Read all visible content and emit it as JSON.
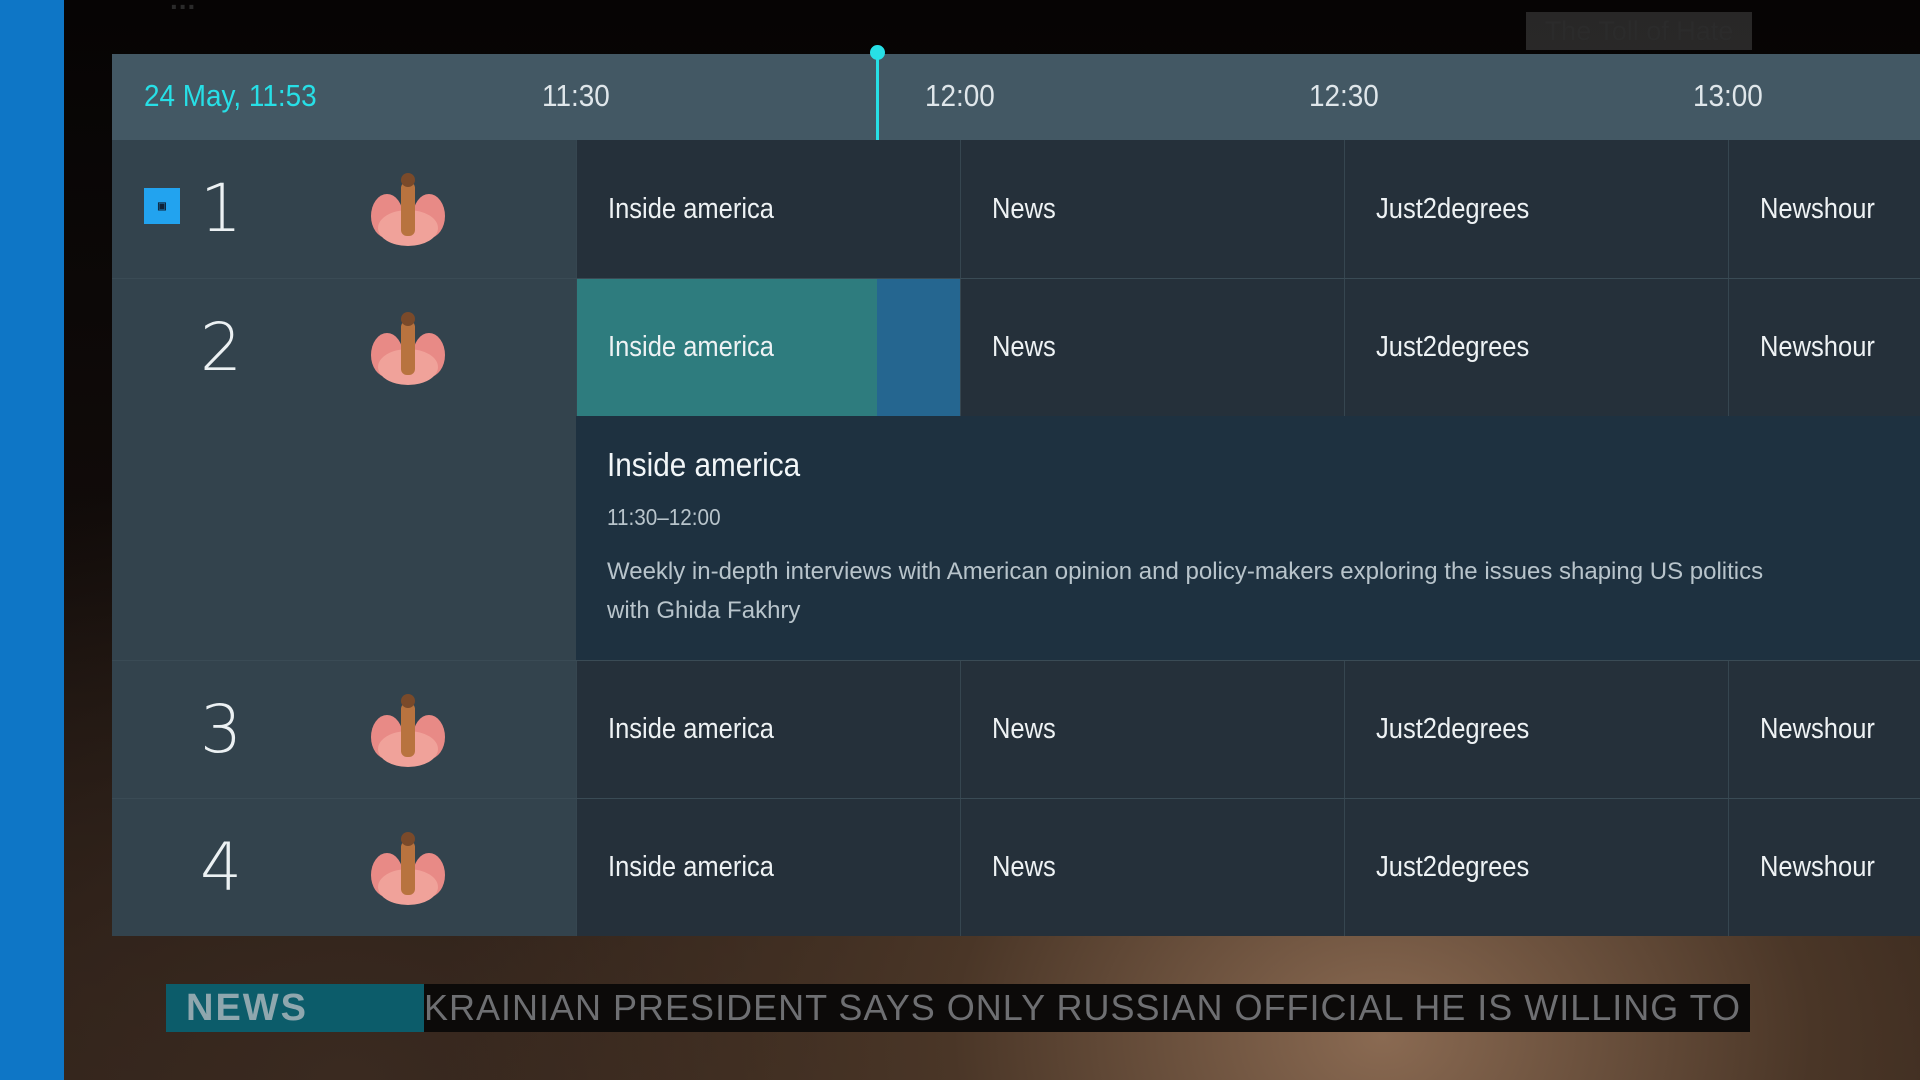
{
  "background": {
    "overlay_caption": "The Toll of Hate",
    "partial_title": "...",
    "ticker": {
      "badge": "NEWS",
      "text": "KRAINIAN PRESIDENT SAYS ONLY RUSSIAN OFFICIAL HE IS WILLING TO ME"
    }
  },
  "guide": {
    "current_datetime": "24 May, 11:53",
    "time_slots": [
      "11:30",
      "12:00",
      "12:30",
      "13:00"
    ],
    "channels": [
      {
        "number": "1",
        "has_badge": true,
        "logo_icon": "channel-logo-icon",
        "programs": [
          "Inside america",
          "News",
          "Just2degrees",
          "Newshour"
        ]
      },
      {
        "number": "2",
        "has_badge": false,
        "logo_icon": "channel-logo-icon",
        "programs": [
          "Inside america",
          "News",
          "Just2degrees",
          "Newshour"
        ]
      },
      {
        "number": "3",
        "has_badge": false,
        "logo_icon": "channel-logo-icon",
        "programs": [
          "Inside america",
          "News",
          "Just2degrees",
          "Newshour"
        ]
      },
      {
        "number": "4",
        "has_badge": false,
        "logo_icon": "channel-logo-icon",
        "programs": [
          "Inside america",
          "News",
          "Just2degrees",
          "Newshour"
        ]
      }
    ],
    "selected_program": {
      "title": "Inside america",
      "time": "11:30–12:00",
      "description": "Weekly in-depth interviews with American opinion and policy-makers exploring the issues shaping US politics with Ghida Fakhry"
    }
  },
  "colors": {
    "accent": "#27dfe6",
    "focused_cell": "#2e7c7e",
    "remaining_cell": "#256690",
    "side_strip": "#0e76c6"
  }
}
